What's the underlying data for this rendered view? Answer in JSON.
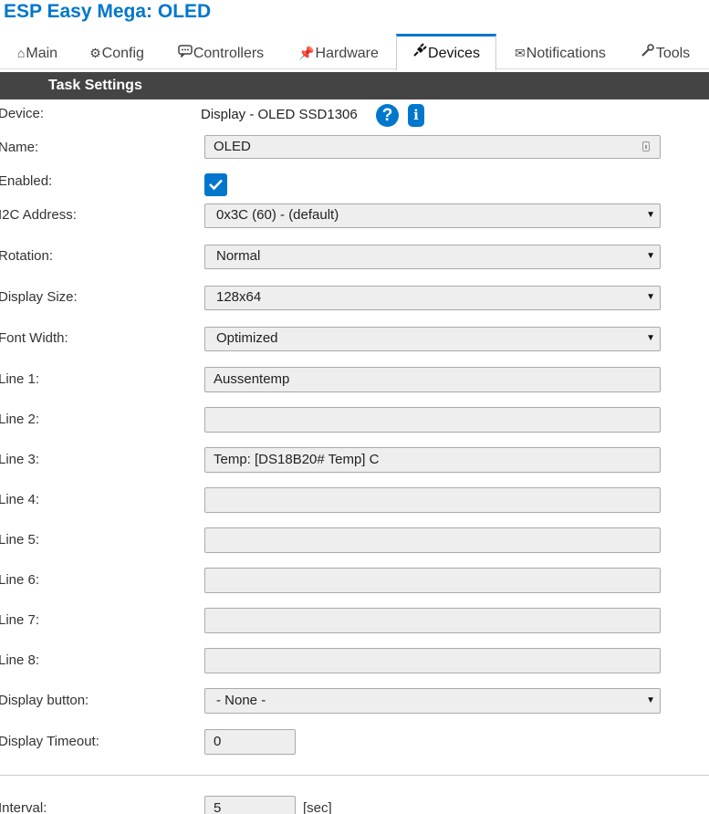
{
  "app": {
    "title": "ESP Easy Mega: OLED"
  },
  "tabs": [
    {
      "label": "Main",
      "icon": "home-icon"
    },
    {
      "label": "Config",
      "icon": "gear-icon"
    },
    {
      "label": "Controllers",
      "icon": "chat-icon"
    },
    {
      "label": "Hardware",
      "icon": "pushpin-icon"
    },
    {
      "label": "Devices",
      "icon": "plug-icon",
      "active": true
    },
    {
      "label": "Notifications",
      "icon": "envelope-icon"
    },
    {
      "label": "Tools",
      "icon": "wrench-icon"
    }
  ],
  "section": {
    "title": "Task Settings"
  },
  "form": {
    "device": {
      "label": "Device:",
      "value": "Display - OLED SSD1306",
      "help": "?",
      "info": "i"
    },
    "name": {
      "label": "Name:",
      "value": "OLED"
    },
    "enabled": {
      "label": "Enabled:",
      "checked": true
    },
    "i2c_address": {
      "label": "I2C Address:",
      "selected": "0x3C (60) - (default)"
    },
    "rotation": {
      "label": "Rotation:",
      "selected": "Normal"
    },
    "display_size": {
      "label": "Display Size:",
      "selected": "128x64"
    },
    "font_width": {
      "label": "Font Width:",
      "selected": "Optimized"
    },
    "lines": [
      {
        "label": "Line 1:",
        "value": "Aussentemp"
      },
      {
        "label": "Line 2:",
        "value": ""
      },
      {
        "label": "Line 3:",
        "value": "Temp: [DS18B20# Temp] C"
      },
      {
        "label": "Line 4:",
        "value": ""
      },
      {
        "label": "Line 5:",
        "value": ""
      },
      {
        "label": "Line 6:",
        "value": ""
      },
      {
        "label": "Line 7:",
        "value": ""
      },
      {
        "label": "Line 8:",
        "value": ""
      }
    ],
    "display_button": {
      "label": "Display button:",
      "selected": "- None -"
    },
    "display_timeout": {
      "label": "Display Timeout:",
      "value": "0"
    },
    "interval": {
      "label": "Interval:",
      "value": "5",
      "unit": "[sec]"
    }
  },
  "colors": {
    "accent": "#0077cc",
    "header_bg": "#444444"
  }
}
